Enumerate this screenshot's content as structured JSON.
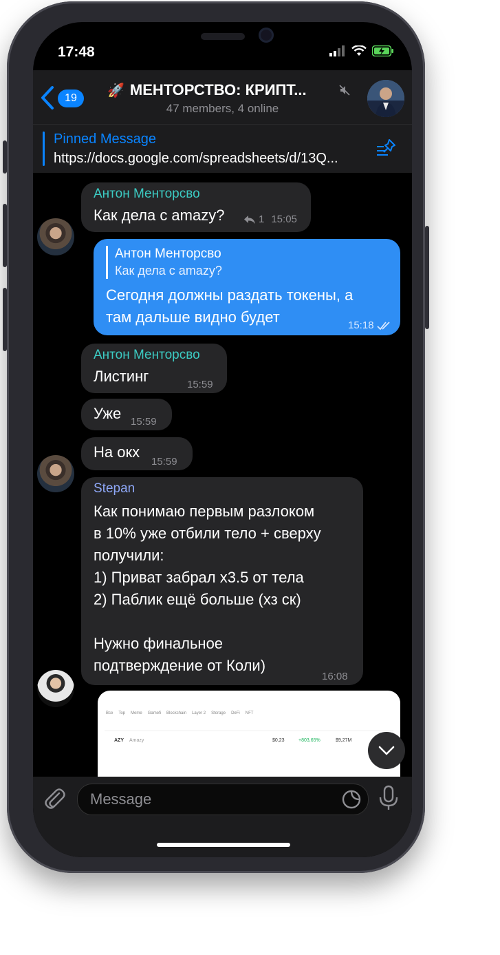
{
  "status": {
    "time": "17:48"
  },
  "header": {
    "back_count": "19",
    "title_emoji": "🚀",
    "title": "МЕНТОРСТВО: КРИПТ...",
    "subtitle": "47 members, 4 online"
  },
  "pinned": {
    "label": "Pinned Message",
    "text": "https://docs.google.com/spreadsheets/d/13Q..."
  },
  "messages": [
    {
      "sender": "Антон Менторсво",
      "text": "Как дела с amazy?",
      "replies": "1",
      "time": "15:05"
    },
    {
      "reply_to_name": "Антон Менторсво",
      "reply_to_text": "Как дела с amazy?",
      "text_line1": "Сегодня должны раздать токены, а",
      "text_line2": "там дальше видно будет",
      "time": "15:18"
    },
    {
      "sender": "Антон Менторсво",
      "text": "Листинг",
      "time": "15:59"
    },
    {
      "text": "Уже",
      "time": "15:59"
    },
    {
      "text": "На окх",
      "time": "15:59"
    },
    {
      "sender": "Stepan",
      "lines": [
        "Как понимаю первым разлоком",
        "в 10% уже отбили тело + сверху",
        "получили:",
        "1) Приват забрал х3.5 от тела",
        "2) Паблик ещё больше (хз ск)",
        "",
        "Нужно финальное",
        "подтверждение от Коли)"
      ],
      "time": "16:08"
    }
  ],
  "media_preview": {
    "tabs": [
      "Все",
      "Top",
      "Meme",
      "Gamefi",
      "Blockchain",
      "Layer 2",
      "Storage",
      "DeFi",
      "NFT"
    ],
    "token": "AZY",
    "token_name": "Amazy",
    "price": "$0,23",
    "change": "+803,65%",
    "cap": "$9,27M"
  },
  "input": {
    "placeholder": "Message"
  },
  "colors": {
    "accent": "#0a84ff",
    "outgoing_bubble": "#2f8ef4",
    "incoming_bubble": "#262628",
    "sender_anton": "#3ccbc3",
    "sender_stepan": "#8ea7f6"
  },
  "icons": [
    "back-chevron-icon",
    "mute-icon",
    "pin-list-icon",
    "reply-arrow-icon",
    "read-checks-icon",
    "chevron-down-icon",
    "paperclip-icon",
    "sticker-icon",
    "microphone-icon",
    "signal-icon",
    "wifi-icon",
    "battery-icon"
  ]
}
